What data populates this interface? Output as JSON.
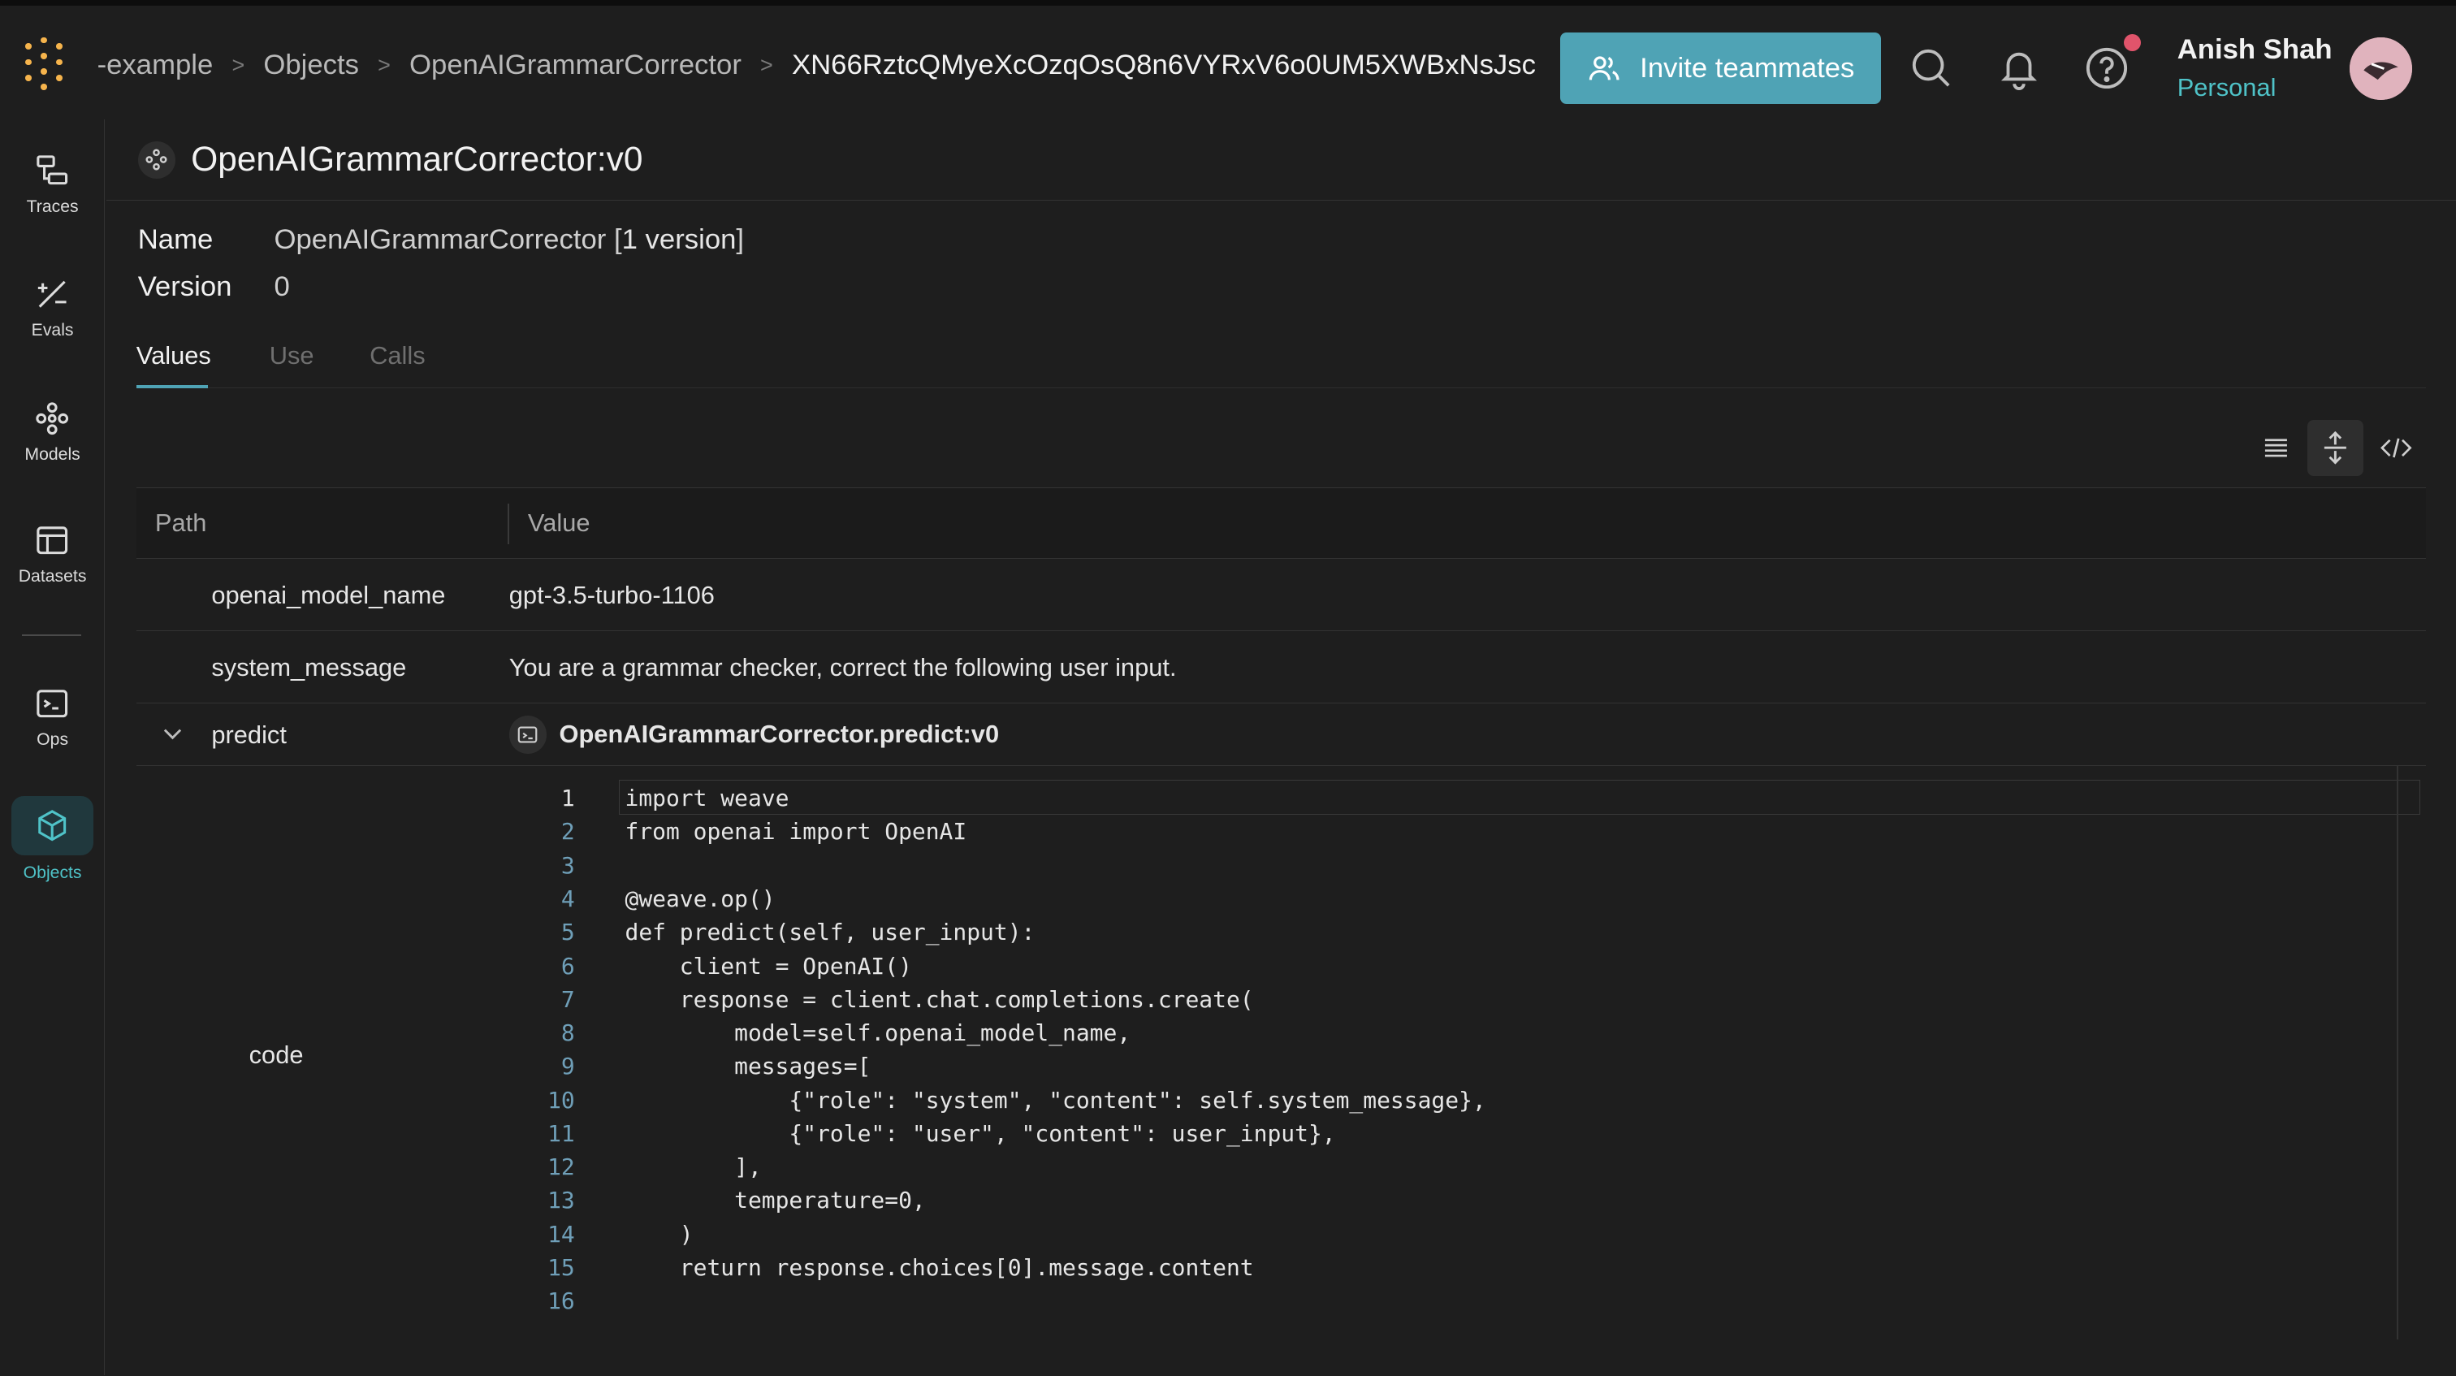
{
  "breadcrumb": [
    "-example",
    "Objects",
    "OpenAIGrammarCorrector",
    "XN66RztcQMyeXcOzqOsQ8n6VYRxV6o0UM5XWBxNsJsc"
  ],
  "header": {
    "invite_label": "Invite teammates",
    "user_name": "Anish Shah",
    "user_sub": "Personal"
  },
  "sidebar": {
    "items": [
      {
        "label": "Traces",
        "icon": "traces-icon"
      },
      {
        "label": "Evals",
        "icon": "evals-icon"
      },
      {
        "label": "Models",
        "icon": "models-icon"
      },
      {
        "label": "Datasets",
        "icon": "datasets-icon"
      },
      {
        "label": "Ops",
        "icon": "ops-icon"
      },
      {
        "label": "Objects",
        "icon": "objects-icon"
      }
    ],
    "active": "Objects"
  },
  "object": {
    "title": "OpenAIGrammarCorrector:v0",
    "name_label": "Name",
    "name_value": "OpenAIGrammarCorrector [",
    "version_count": "1 version",
    "name_suffix": "]",
    "version_label": "Version",
    "version_value": "0"
  },
  "tabs": [
    {
      "label": "Values",
      "active": true
    },
    {
      "label": "Use",
      "active": false
    },
    {
      "label": "Calls",
      "active": false
    }
  ],
  "table": {
    "headers": {
      "path": "Path",
      "value": "Value"
    },
    "rows": [
      {
        "key": "openai_model_name",
        "value": "gpt-3.5-turbo-1106"
      },
      {
        "key": "system_message",
        "value": "You are a grammar checker, correct the following user input."
      }
    ],
    "predict": {
      "key": "predict",
      "value": "OpenAIGrammarCorrector.predict:v0"
    },
    "code_label": "code"
  },
  "code_lines": [
    "import weave",
    "from openai import OpenAI",
    "",
    "@weave.op()",
    "def predict(self, user_input):",
    "    client = OpenAI()",
    "    response = client.chat.completions.create(",
    "        model=self.openai_model_name,",
    "        messages=[",
    "            {\"role\": \"system\", \"content\": self.system_message},",
    "            {\"role\": \"user\", \"content\": user_input},",
    "        ],",
    "        temperature=0,",
    "    )",
    "    return response.choices[0].message.content",
    ""
  ],
  "colors": {
    "accent": "#4fa3b5",
    "logo": "#f6b44c",
    "notification": "#e0546b"
  }
}
